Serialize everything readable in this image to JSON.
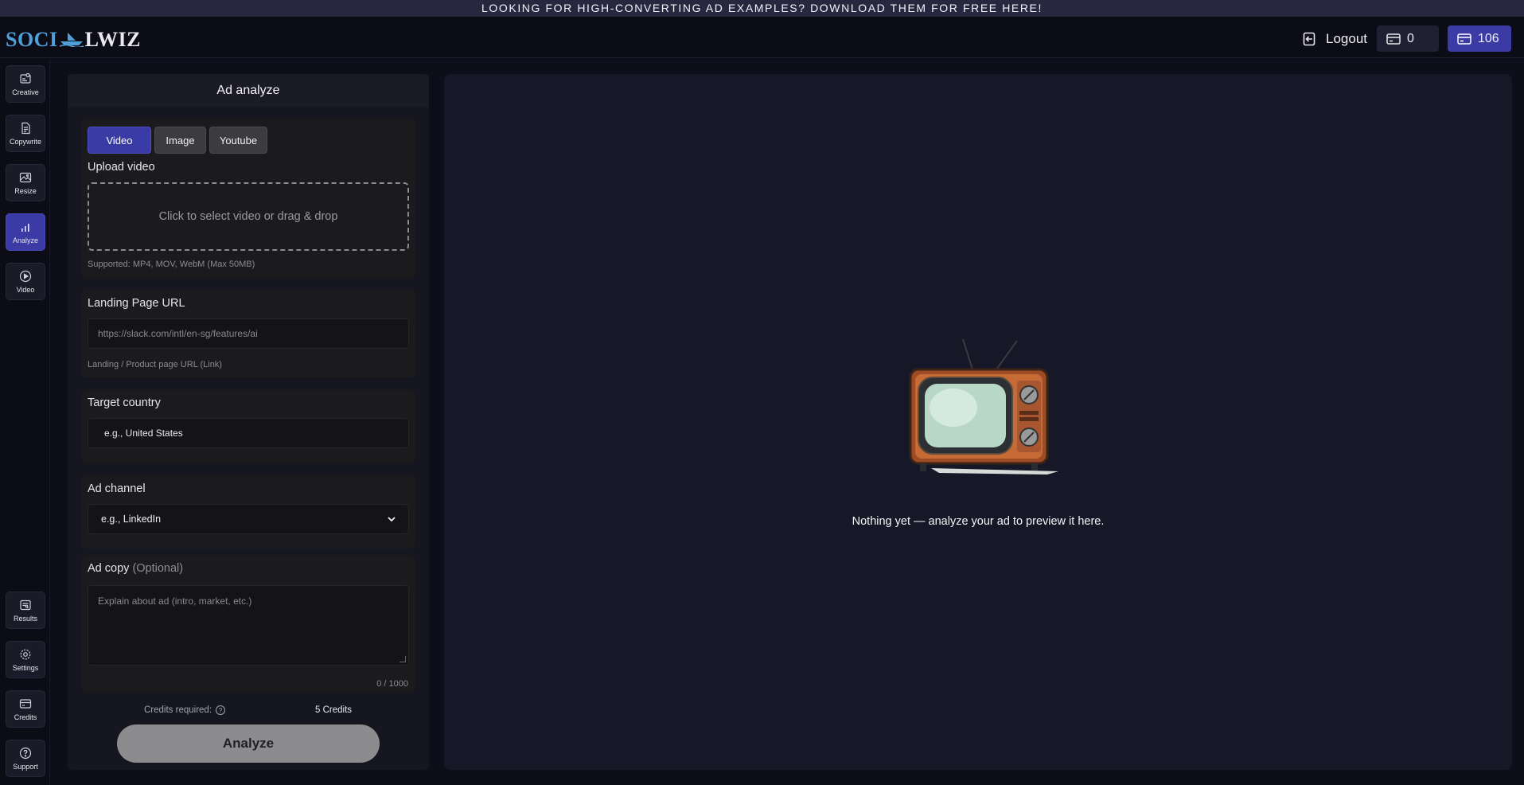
{
  "banner": {
    "text": "LOOKING FOR HIGH-CONVERTING AD EXAMPLES? DOWNLOAD THEM FOR FREE HERE!"
  },
  "header": {
    "logo_part1": "SOCI",
    "logo_part2": "LWIZ",
    "logout_label": "Logout",
    "wallet_count": "0",
    "credits_count": "106"
  },
  "sidebar": {
    "top": [
      {
        "label": "Creative",
        "icon": "creative-icon"
      },
      {
        "label": "Copywrite",
        "icon": "document-icon"
      },
      {
        "label": "Resize",
        "icon": "images-icon"
      },
      {
        "label": "Analyze",
        "icon": "bar-chart-icon",
        "active": true
      },
      {
        "label": "Video",
        "icon": "play-circle-icon"
      }
    ],
    "bottom": [
      {
        "label": "Results",
        "icon": "results-icon"
      },
      {
        "label": "Settings",
        "icon": "gear-icon"
      },
      {
        "label": "Credits",
        "icon": "credit-card-icon"
      },
      {
        "label": "Support",
        "icon": "help-icon"
      }
    ]
  },
  "form": {
    "title": "Ad analyze",
    "tabs": [
      "Video",
      "Image",
      "Youtube"
    ],
    "upload_title": "Upload video",
    "upload_prompt": "Click to select video or drag & drop",
    "upload_hint": "Supported: MP4, MOV, WebM (Max 50MB)",
    "landing_title": "Landing Page URL",
    "landing_placeholder": "https://slack.com/intl/en-sg/features/ai",
    "landing_hint": "Landing / Product page URL (Link)",
    "country_title": "Target country",
    "country_placeholder": "e.g., United States",
    "channel_title": "Ad channel",
    "channel_selected": "e.g., LinkedIn",
    "copy_title": "Ad copy",
    "copy_optional": "(Optional)",
    "copy_placeholder": "Explain about ad (intro, market, etc.)",
    "copy_counter": "0 / 1000",
    "credits_required_label": "Credits required:",
    "credits_required_value": "5 Credits",
    "analyze_label": "Analyze"
  },
  "preview": {
    "empty_message": "Nothing yet — analyze your ad to preview it here."
  },
  "colors": {
    "accent": "#3c3ba5",
    "background": "#0e0e1a",
    "panel": "#161621",
    "preview_panel": "#171827"
  }
}
